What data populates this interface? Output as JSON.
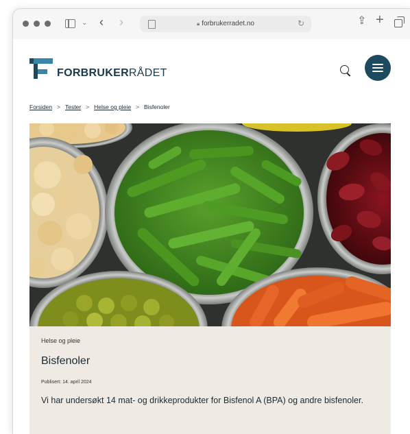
{
  "browser": {
    "url": "forbrukerradet.no"
  },
  "header": {
    "logo_bold": "FORBRUKER",
    "logo_light": "RÅDET"
  },
  "breadcrumb": {
    "items": [
      "Forsiden",
      "Tester",
      "Helse og pleie",
      "Bisfenoler"
    ]
  },
  "article": {
    "category": "Helse og pleie",
    "title": "Bisfenoler",
    "published": "Publisert: 14. april 2024",
    "summary": "Vi har undersøkt 14 mat- og drikkeprodukter for Bisfenol A (BPA) og andre bisfenoler."
  },
  "icons": {
    "nav": [
      "sidebar-icon",
      "chevron-down-icon",
      "back-arrow-icon",
      "forward-arrow-icon",
      "document-icon",
      "lock-icon",
      "reload-icon",
      "share-icon",
      "plus-icon",
      "tabs-icon",
      "search-icon",
      "menu-icon"
    ]
  },
  "colors": {
    "brand": "#1d4a5e",
    "logo_accent": "#3a86a8",
    "card_background": "#efebe4"
  }
}
